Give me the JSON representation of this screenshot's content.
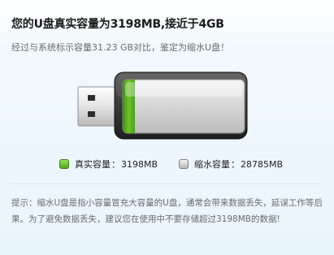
{
  "header": {
    "title": "您的U盘真实容量为3198MB,接近于4GB",
    "subtitle": "经过与系统标示容量31.23 GB对比，鉴定为缩水U盘！"
  },
  "illustration": {
    "icon": "usb-drive-icon",
    "real_fraction": 0.1,
    "colors": {
      "real": "#5bb21f",
      "expanded": "#c8c8c8"
    }
  },
  "legend": {
    "real_label": "真实容量",
    "real_value": "3198MB",
    "expanded_label": "缩水容量",
    "expanded_value": "28785MB",
    "separator": "："
  },
  "tip": {
    "text": "提示：缩水U盘是指小容量冒充大容量的U盘，通常会带来数据丢失，延误工作等后果。为了避免数据丢失，建议您在使用中不要存储超过3198MB的数据!"
  }
}
